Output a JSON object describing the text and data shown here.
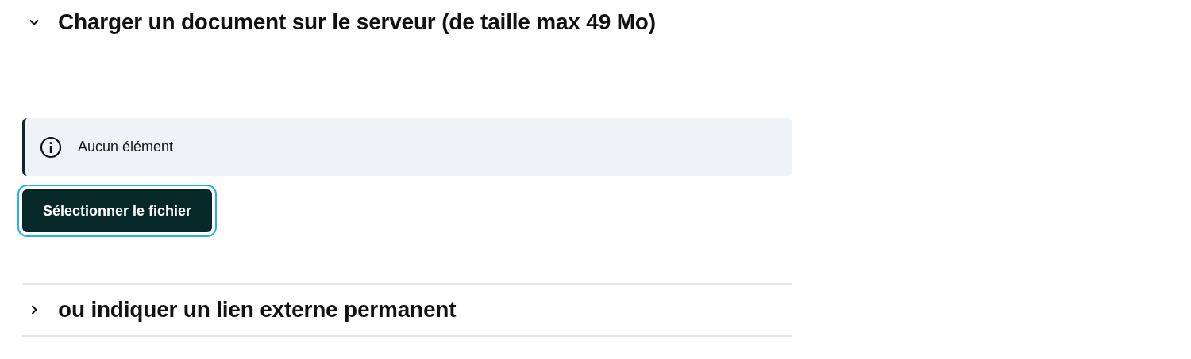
{
  "sections": [
    {
      "title": "Charger un document sur le serveur (de taille max 49 Mo)",
      "expanded": true,
      "alert": {
        "text": "Aucun élément"
      },
      "button": {
        "label": "Sélectionner le fichier",
        "focused": true
      }
    },
    {
      "title": "ou indiquer un lien externe permanent",
      "expanded": false
    }
  ]
}
